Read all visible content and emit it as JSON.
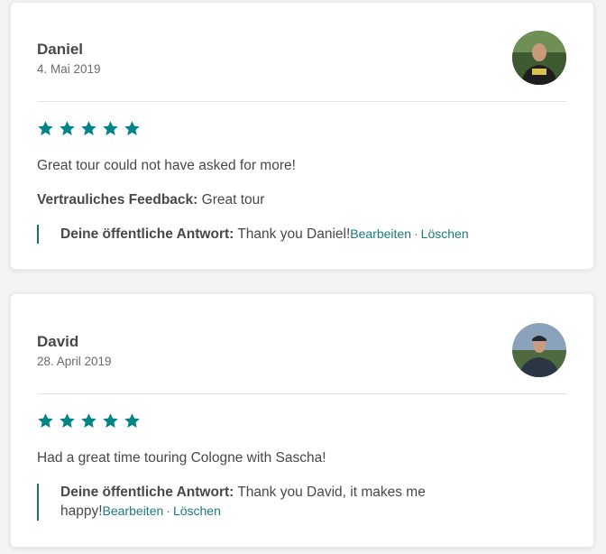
{
  "colors": {
    "accent": "#008489",
    "link": "#1c7b7b",
    "text": "#484848",
    "muted": "#6b6b6b"
  },
  "reviews": [
    {
      "name": "Daniel",
      "date": "4. Mai 2019",
      "rating": 5,
      "comment": "Great tour could not have asked for more!",
      "feedback_label": "Vertrauliches Feedback:",
      "feedback_text": "Great tour",
      "reply_label": "Deine öffentliche Antwort:",
      "reply_text": "Thank you Daniel!",
      "edit_label": "Bearbeiten",
      "separator": "·",
      "delete_label": "Löschen"
    },
    {
      "name": "David",
      "date": "28. April 2019",
      "rating": 5,
      "comment": "Had a great time touring Cologne with Sascha!",
      "reply_label": "Deine öffentliche Antwort:",
      "reply_text": "Thank you David, it makes me happy!",
      "edit_label": "Bearbeiten",
      "separator": "·",
      "delete_label": "Löschen"
    }
  ]
}
